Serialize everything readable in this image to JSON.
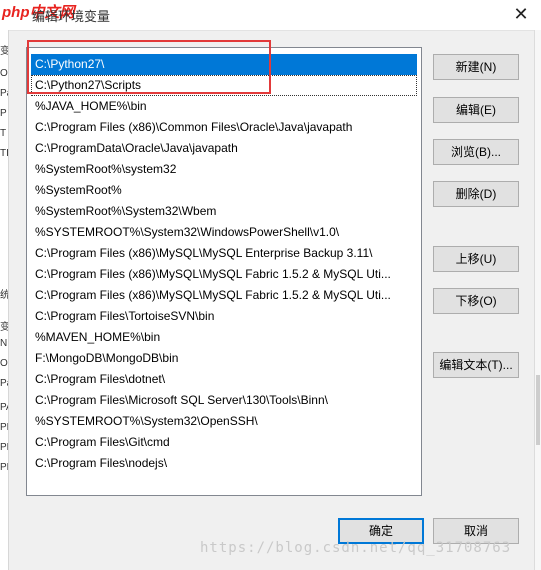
{
  "window": {
    "title": "编辑环境变量",
    "logo_text": "php中文网",
    "close_glyph": "✕"
  },
  "left_fragments": [
    "变",
    "O",
    "Pa",
    "P",
    "T",
    "TI",
    "统",
    "变",
    "N",
    "O",
    "Pa",
    "PA",
    "PF",
    "PF",
    "PF"
  ],
  "path_list": {
    "items": [
      "C:\\Python27\\",
      "C:\\Python27\\Scripts",
      "%JAVA_HOME%\\bin",
      "C:\\Program Files (x86)\\Common Files\\Oracle\\Java\\javapath",
      "C:\\ProgramData\\Oracle\\Java\\javapath",
      "%SystemRoot%\\system32",
      "%SystemRoot%",
      "%SystemRoot%\\System32\\Wbem",
      "%SYSTEMROOT%\\System32\\WindowsPowerShell\\v1.0\\",
      "C:\\Program Files (x86)\\MySQL\\MySQL Enterprise Backup 3.11\\",
      "C:\\Program Files (x86)\\MySQL\\MySQL Fabric 1.5.2 & MySQL Uti...",
      "C:\\Program Files (x86)\\MySQL\\MySQL Fabric 1.5.2 & MySQL Uti...",
      "C:\\Program Files\\TortoiseSVN\\bin",
      "%MAVEN_HOME%\\bin",
      "F:\\MongoDB\\MongoDB\\bin",
      "C:\\Program Files\\dotnet\\",
      "C:\\Program Files\\Microsoft SQL Server\\130\\Tools\\Binn\\",
      "%SYSTEMROOT%\\System32\\OpenSSH\\",
      "C:\\Program Files\\Git\\cmd",
      "C:\\Program Files\\nodejs\\"
    ]
  },
  "buttons": {
    "new": "新建(N)",
    "edit": "编辑(E)",
    "browse": "浏览(B)...",
    "delete": "删除(D)",
    "move_up": "上移(U)",
    "move_down": "下移(O)",
    "edit_text": "编辑文本(T)...",
    "ok": "确定",
    "cancel": "取消"
  },
  "watermark": "https://blog.csdn.net/qq_31708763"
}
